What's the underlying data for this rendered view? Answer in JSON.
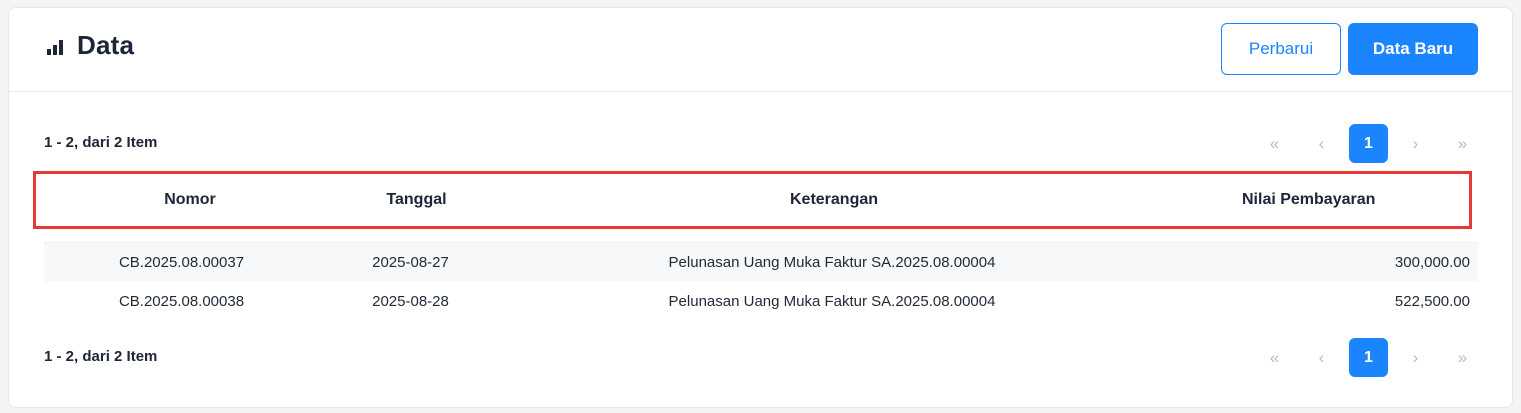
{
  "header": {
    "title": "Data",
    "buttons": {
      "refresh": "Perbarui",
      "new": "Data Baru"
    }
  },
  "pagination": {
    "summary": "1 - 2, dari 2 Item",
    "first": "«",
    "prev": "‹",
    "current": "1",
    "next": "›",
    "last": "»"
  },
  "table": {
    "columns": [
      "Nomor",
      "Tanggal",
      "Keterangan",
      "Nilai Pembayaran"
    ],
    "rows": [
      [
        "CB.2025.08.00037",
        "2025-08-27",
        "Pelunasan Uang Muka Faktur SA.2025.08.00004",
        "300,000.00"
      ],
      [
        "CB.2025.08.00038",
        "2025-08-28",
        "Pelunasan Uang Muka Faktur SA.2025.08.00004",
        "522,500.00"
      ]
    ]
  },
  "icons": {
    "title": "bar-chart-icon"
  },
  "colors": {
    "primary": "#1b84ff",
    "highlight": "#e53935",
    "text": "#1e2538"
  }
}
